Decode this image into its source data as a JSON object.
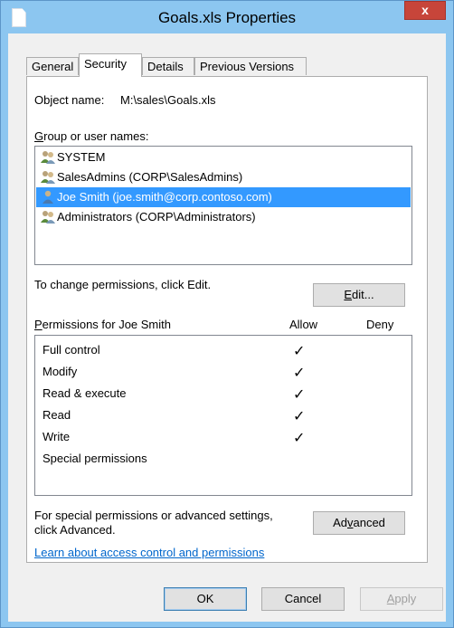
{
  "window": {
    "title": "Goals.xls Properties",
    "close_glyph": "x"
  },
  "tabs": [
    {
      "label": "General",
      "active": false
    },
    {
      "label": "Security",
      "active": true
    },
    {
      "label": "Details",
      "active": false
    },
    {
      "label": "Previous Versions",
      "active": false
    }
  ],
  "object": {
    "label": "Object name:",
    "value": "M:\\sales\\Goals.xls"
  },
  "users": {
    "label_accel": "G",
    "label_rest": "roup or user names:",
    "items": [
      {
        "name": "SYSTEM",
        "icon": "group-users-icon",
        "selected": false
      },
      {
        "name": "SalesAdmins (CORP\\SalesAdmins)",
        "icon": "group-users-icon",
        "selected": false
      },
      {
        "name": "Joe Smith (joe.smith@corp.contoso.com)",
        "icon": "single-user-icon",
        "selected": true
      },
      {
        "name": "Administrators (CORP\\Administrators)",
        "icon": "group-users-icon",
        "selected": false
      }
    ]
  },
  "change": {
    "text": "To change permissions, click Edit.",
    "edit_accel": "E",
    "edit_rest": "dit..."
  },
  "permissions": {
    "header_accel": "P",
    "header_rest": "ermissions for Joe Smith",
    "allow_label": "Allow",
    "deny_label": "Deny",
    "rows": [
      {
        "name": "Full control",
        "allow": true,
        "deny": false
      },
      {
        "name": "Modify",
        "allow": true,
        "deny": false
      },
      {
        "name": "Read & execute",
        "allow": true,
        "deny": false
      },
      {
        "name": "Read",
        "allow": true,
        "deny": false
      },
      {
        "name": "Write",
        "allow": true,
        "deny": false
      },
      {
        "name": "Special permissions",
        "allow": false,
        "deny": false
      }
    ],
    "check_glyph": "✓"
  },
  "advanced": {
    "text_line1": "For special permissions or advanced settings,",
    "text_line2": "click Advanced.",
    "btn_pre": "Ad",
    "btn_accel": "v",
    "btn_post": "anced"
  },
  "learn_link": "Learn about access control and permissions",
  "footer": {
    "ok": "OK",
    "cancel": "Cancel",
    "apply_accel": "A",
    "apply_rest": "pply"
  },
  "colors": {
    "selection": "#3399ff",
    "link": "#0066cc",
    "close": "#c7453a",
    "frame": "#8cc6f0"
  }
}
